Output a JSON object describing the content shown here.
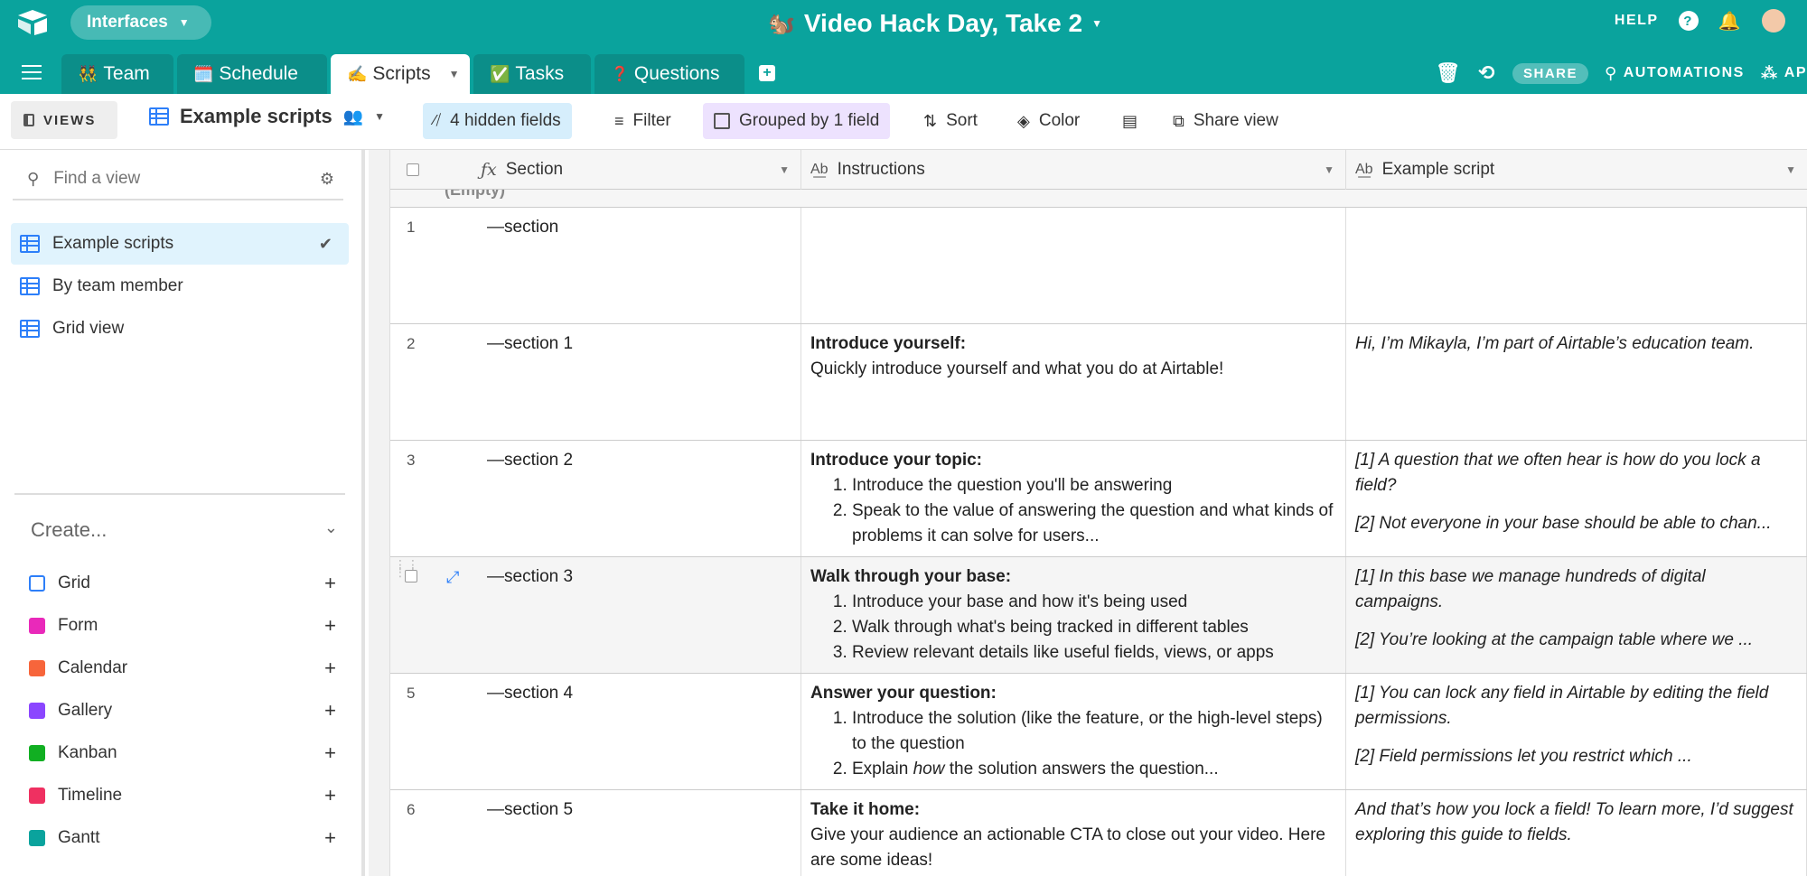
{
  "topbar": {
    "interfaces_label": "Interfaces",
    "base_title": "Video Hack Day, Take 2",
    "base_emoji": "🐿️",
    "help_label": "HELP"
  },
  "tabs": [
    {
      "emoji": "👯",
      "label": "Team"
    },
    {
      "emoji": "🗓️",
      "label": "Schedule"
    },
    {
      "emoji": "✍️",
      "label": "Scripts"
    },
    {
      "emoji": "✅",
      "label": "Tasks"
    },
    {
      "emoji": "❓",
      "label": "Questions"
    }
  ],
  "tabs_right": {
    "share_label": "SHARE",
    "automations_label": "AUTOMATIONS",
    "apps_label": "AP"
  },
  "toolbar": {
    "views_label": "VIEWS",
    "view_name": "Example scripts",
    "hidden_fields": "4 hidden fields",
    "filter": "Filter",
    "grouped": "Grouped by 1 field",
    "sort": "Sort",
    "color": "Color",
    "share_view": "Share view"
  },
  "sidebar": {
    "search_placeholder": "Find a view",
    "views": [
      {
        "label": "Example scripts"
      },
      {
        "label": "By team member"
      },
      {
        "label": "Grid view"
      }
    ],
    "create_label": "Create...",
    "create_items": [
      {
        "label": "Grid",
        "color": "#2d7ff9"
      },
      {
        "label": "Form",
        "color": "#e929ba"
      },
      {
        "label": "Calendar",
        "color": "#f7653b"
      },
      {
        "label": "Gallery",
        "color": "#8b46ff"
      },
      {
        "label": "Kanban",
        "color": "#11af22"
      },
      {
        "label": "Timeline",
        "color": "#ef3061"
      },
      {
        "label": "Gantt",
        "color": "#0aa39d"
      }
    ]
  },
  "grid": {
    "columns": [
      "Section",
      "Instructions",
      "Example script"
    ],
    "group_label": "(Empty)",
    "rows": [
      {
        "num": "1",
        "section": "—section"
      },
      {
        "num": "2",
        "section": "—section 1",
        "ins_title": "Introduce yourself:",
        "ins_text": "Quickly introduce yourself and what you do at Airtable!",
        "ex1": "Hi, I’m Mikayla, I’m part of Airtable’s education team."
      },
      {
        "num": "3",
        "section": "—section 2",
        "ins_title": "Introduce your topic:",
        "ins_list": [
          "Introduce the question you'll be answering",
          "Speak to the value of answering the question and what kinds of problems it can solve for users..."
        ],
        "ex1": "[1] A question that we often hear is how do you lock a field?",
        "ex2": "[2] Not everyone in your base should be able to chan..."
      },
      {
        "num": "",
        "section": "—section 3",
        "ins_title": "Walk through your base:",
        "ins_list": [
          "Introduce your base and how it's being used",
          "Walk through what's being tracked in different tables",
          "Review relevant details like useful fields, views, or apps"
        ],
        "ex1": "[1] In this base we manage hundreds of digital campaigns.",
        "ex2": "[2] You’re looking at the campaign table where we ..."
      },
      {
        "num": "5",
        "section": "—section 4",
        "ins_title": "Answer your question:",
        "ins_list": [
          "Introduce the solution (like the feature, or the high-level steps) to the question",
          "how the solution answers the question..."
        ],
        "ins_list_prefix": "Explain",
        "ex1": "[1] You can lock any field in Airtable by editing the field permissions.",
        "ex2": "[2] Field permissions let you restrict which ..."
      },
      {
        "num": "6",
        "section": "—section 5",
        "ins_title": "Take it home:",
        "ins_text": "Give your audience an actionable CTA to close out your video. Here are some ideas!",
        "ex1": "And that’s how you lock a field! To learn more, I’d suggest exploring this guide to fields."
      }
    ]
  }
}
